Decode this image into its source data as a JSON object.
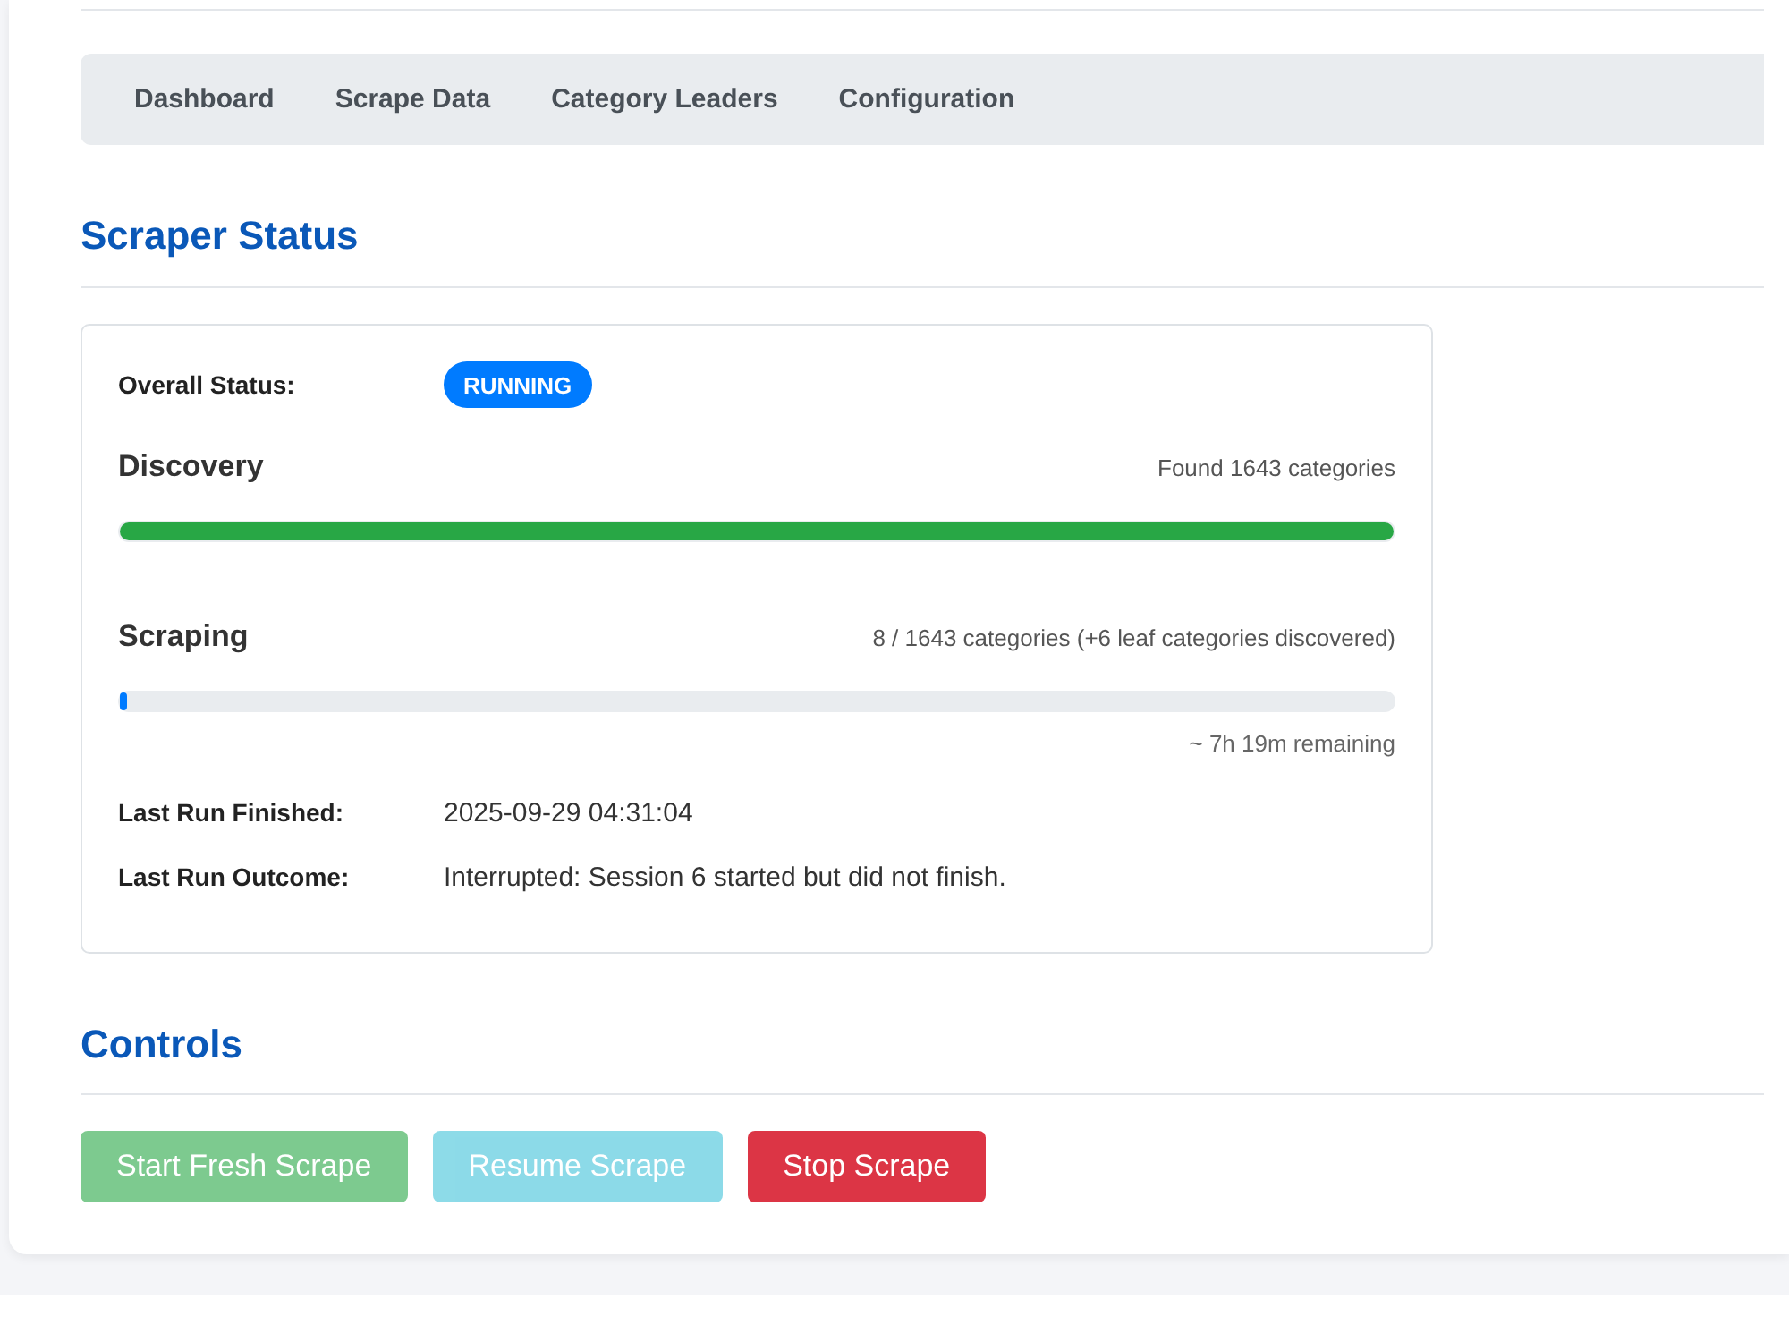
{
  "nav": [
    "Dashboard",
    "Scrape Data",
    "Category Leaders",
    "Configuration"
  ],
  "scraper_status": {
    "title": "Scraper Status",
    "overall_status": {
      "label": "Overall Status:",
      "badge": "RUNNING"
    },
    "progress": [
      {
        "name": "Discovery",
        "detail": "Found 1643 categories",
        "level": 1,
        "color": "#28a745"
      },
      {
        "name": "Scraping",
        "detail": "8 / 1643 categories (+6 leaf categories discovered)",
        "level": 0.005,
        "color": "#007bff",
        "remaining": "~ 7h 19m remaining"
      }
    ],
    "details": [
      {
        "label": "Last Run Finished:",
        "value": "2025-09-29 04:31:04"
      },
      {
        "label": "Last Run Outcome:",
        "value": "Interrupted: Session 6 started but did not finish."
      }
    ]
  },
  "controls": {
    "title": "Controls",
    "buttons": [
      {
        "label": "Start Fresh Scrape",
        "kind": "success",
        "disabled": true
      },
      {
        "label": "Resume Scrape",
        "kind": "info",
        "disabled": true
      },
      {
        "label": "Stop Scrape",
        "kind": "danger",
        "disabled": false
      }
    ]
  }
}
